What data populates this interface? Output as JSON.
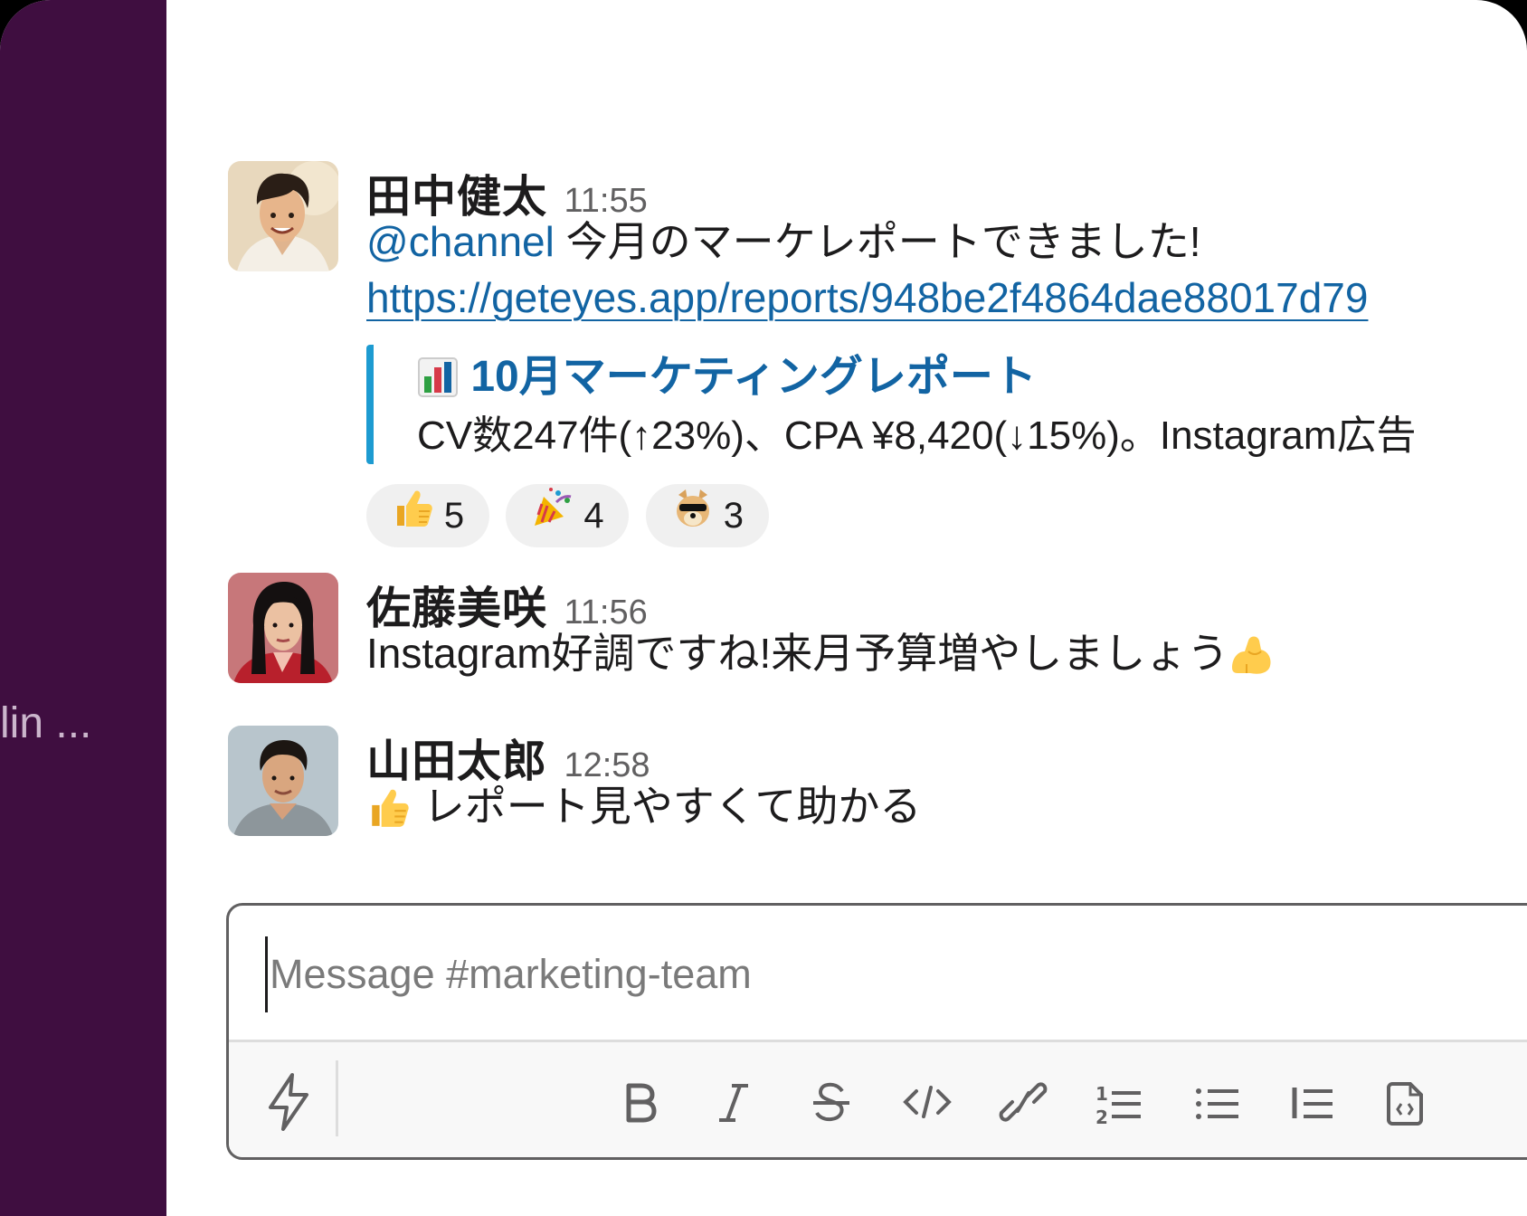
{
  "sidebar": {
    "truncated_item": "lin ..."
  },
  "messages": [
    {
      "author": "田中健太",
      "time": "11:55",
      "mention": "@channel",
      "text": " 今月のマーケレポートできました!",
      "link": "https://geteyes.app/reports/948be2f4864dae88017d79",
      "unfurl": {
        "icon": "bar-chart-emoji",
        "title": "10月マーケティングレポート",
        "description": "CV数247件(↑23%)、CPA ¥8,420(↓15%)。Instagram広告"
      },
      "reactions": [
        {
          "emoji": "thumbs-up-emoji",
          "count": "5"
        },
        {
          "emoji": "party-popper-emoji",
          "count": "4"
        },
        {
          "emoji": "doge-sunglasses-emoji",
          "count": "3"
        }
      ]
    },
    {
      "author": "佐藤美咲",
      "time": "11:56",
      "text": "Instagram好調ですね!来月予算増やしましょう",
      "trailing_emoji": "flexed-biceps-emoji"
    },
    {
      "author": "山田太郎",
      "time": "12:58",
      "leading_emoji": "thumbs-up-emoji",
      "text": " レポート見やすくて助かる"
    }
  ],
  "composer": {
    "placeholder": "Message #marketing-team",
    "toolbar": [
      "shortcuts",
      "bold",
      "italic",
      "strikethrough",
      "code",
      "link",
      "ordered-list",
      "bulleted-list",
      "blockquote",
      "code-block"
    ]
  },
  "colors": {
    "sidebar": "#3f0e40",
    "link": "#1264a3",
    "unfurl_bar": "#1d9bd1"
  }
}
